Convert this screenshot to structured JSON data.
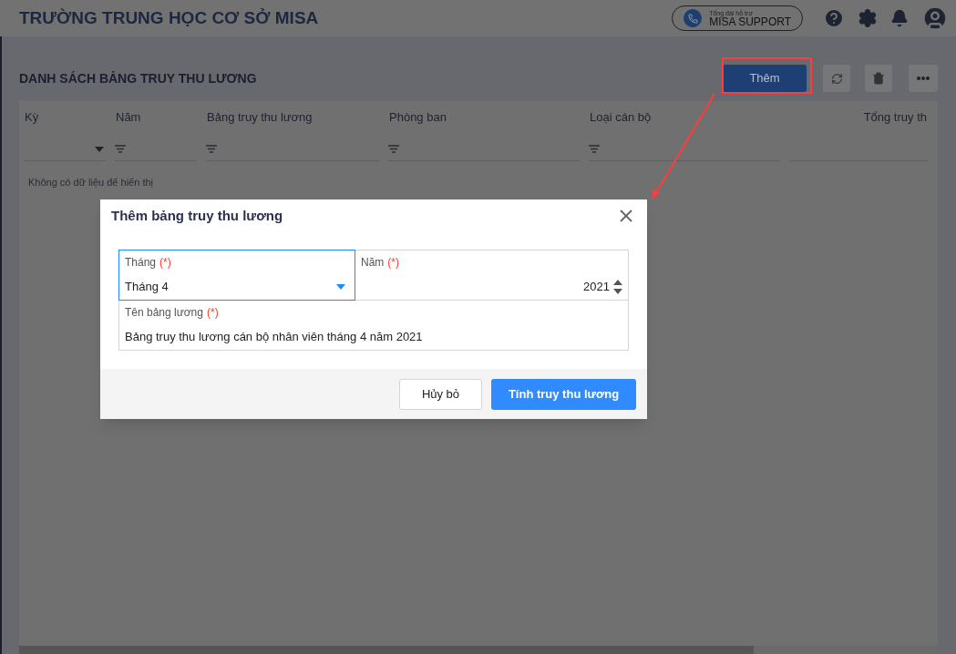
{
  "header": {
    "title": "TRƯỜNG TRUNG HỌC CƠ SỞ MISA",
    "support": {
      "caption": "Tổng đài hỗ trợ",
      "label": "MISA SUPPORT"
    }
  },
  "page": {
    "title": "DANH SÁCH BẢNG TRUY THU LƯƠNG",
    "add_button": "Thêm"
  },
  "table": {
    "columns": [
      {
        "label": "Kỳ",
        "kind": "dropdown"
      },
      {
        "label": "Năm",
        "kind": "filter"
      },
      {
        "label": "Bảng truy thu lương",
        "kind": "filter"
      },
      {
        "label": "Phòng ban",
        "kind": "filter"
      },
      {
        "label": "Loại cán bộ",
        "kind": "filter"
      },
      {
        "label": "Tổng truy th",
        "kind": "plain"
      }
    ],
    "empty_text": "Không có dữ liệu để hiển thị"
  },
  "dialog": {
    "title": "Thêm bảng truy thu lương",
    "fields": [
      {
        "kind": "select",
        "label": "Tháng",
        "required_mark": "(*)",
        "value": "Tháng 4",
        "focused": true
      },
      {
        "kind": "number",
        "label": "Năm",
        "required_mark": "(*)",
        "value": "2021",
        "focused": false
      },
      {
        "kind": "text",
        "label": "Tên bảng lương",
        "required_mark": "(*)",
        "value": "Bảng truy thu lương cán bộ nhân viên tháng 4 năm 2021",
        "focused": false
      }
    ],
    "cancel_button": "Hủy bỏ",
    "submit_button": "Tính truy thu lương"
  }
}
